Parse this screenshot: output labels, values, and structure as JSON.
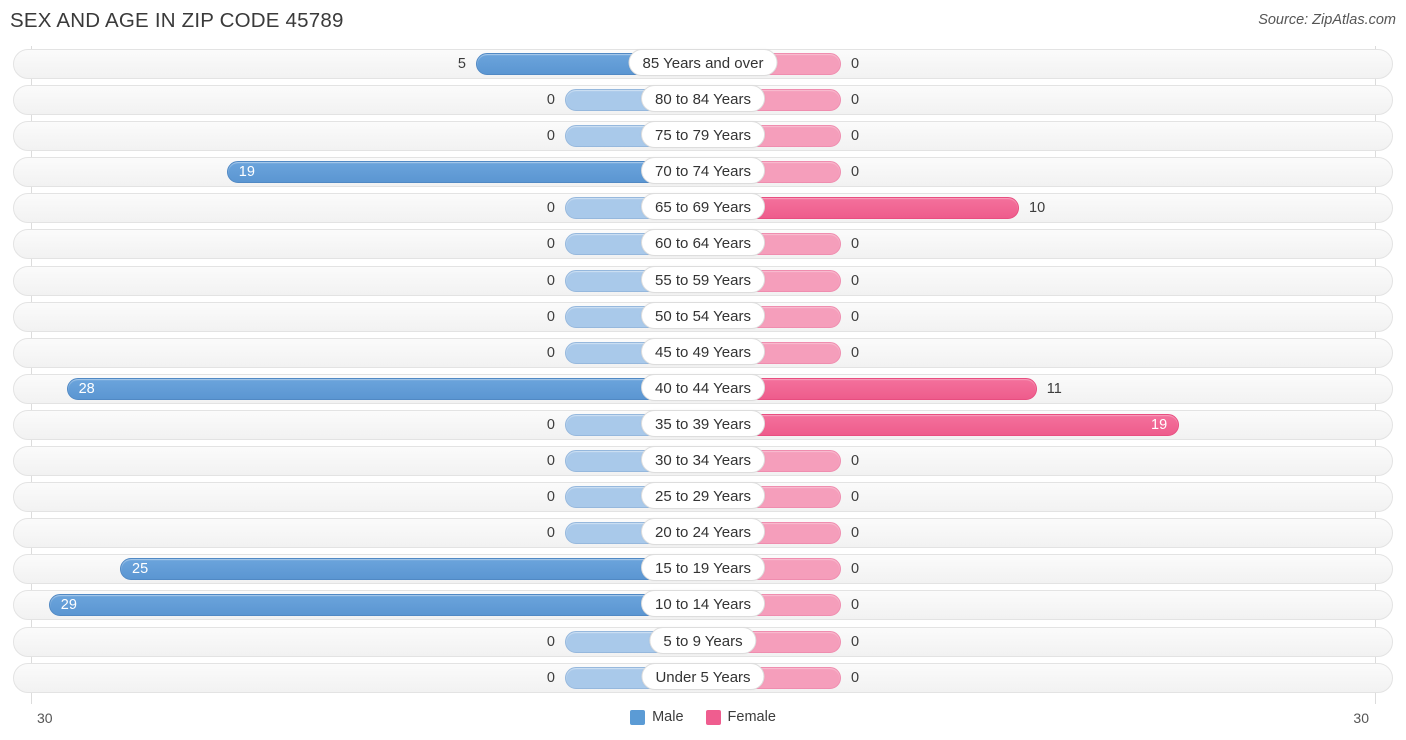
{
  "header": {
    "title": "SEX AND AGE IN ZIP CODE 45789",
    "source": "Source: ZipAtlas.com"
  },
  "legend": {
    "male_label": "Male",
    "female_label": "Female",
    "male_color": "#5b9bd5",
    "female_color": "#ef5d8f"
  },
  "axis": {
    "left_end": "30",
    "right_end": "30",
    "max": 30
  },
  "chart_data": {
    "type": "bar",
    "title": "SEX AND AGE IN ZIP CODE 45789",
    "subtitle": "Source: ZipAtlas.com",
    "orientation": "horizontal",
    "style": "population-pyramid",
    "xlabel": "",
    "ylabel": "",
    "xlim": [
      30,
      30
    ],
    "grid": true,
    "legend_position": "bottom-center",
    "categories": [
      "85 Years and over",
      "80 to 84 Years",
      "75 to 79 Years",
      "70 to 74 Years",
      "65 to 69 Years",
      "60 to 64 Years",
      "55 to 59 Years",
      "50 to 54 Years",
      "45 to 49 Years",
      "40 to 44 Years",
      "35 to 39 Years",
      "30 to 34 Years",
      "25 to 29 Years",
      "20 to 24 Years",
      "15 to 19 Years",
      "10 to 14 Years",
      "5 to 9 Years",
      "Under 5 Years"
    ],
    "series": [
      {
        "name": "Male",
        "color": "#5b9bd5",
        "values": [
          5,
          0,
          0,
          19,
          0,
          0,
          0,
          0,
          0,
          28,
          0,
          0,
          0,
          0,
          25,
          29,
          0,
          0
        ]
      },
      {
        "name": "Female",
        "color": "#ef5d8f",
        "values": [
          0,
          0,
          0,
          0,
          10,
          0,
          0,
          0,
          0,
          11,
          19,
          0,
          0,
          0,
          0,
          0,
          0,
          0
        ]
      }
    ]
  },
  "rows": [
    {
      "label": "85 Years and over",
      "male": "5",
      "female": "0"
    },
    {
      "label": "80 to 84 Years",
      "male": "0",
      "female": "0"
    },
    {
      "label": "75 to 79 Years",
      "male": "0",
      "female": "0"
    },
    {
      "label": "70 to 74 Years",
      "male": "19",
      "female": "0"
    },
    {
      "label": "65 to 69 Years",
      "male": "0",
      "female": "10"
    },
    {
      "label": "60 to 64 Years",
      "male": "0",
      "female": "0"
    },
    {
      "label": "55 to 59 Years",
      "male": "0",
      "female": "0"
    },
    {
      "label": "50 to 54 Years",
      "male": "0",
      "female": "0"
    },
    {
      "label": "45 to 49 Years",
      "male": "0",
      "female": "0"
    },
    {
      "label": "40 to 44 Years",
      "male": "28",
      "female": "11"
    },
    {
      "label": "35 to 39 Years",
      "male": "0",
      "female": "19"
    },
    {
      "label": "30 to 34 Years",
      "male": "0",
      "female": "0"
    },
    {
      "label": "25 to 29 Years",
      "male": "0",
      "female": "0"
    },
    {
      "label": "20 to 24 Years",
      "male": "0",
      "female": "0"
    },
    {
      "label": "15 to 19 Years",
      "male": "25",
      "female": "0"
    },
    {
      "label": "10 to 14 Years",
      "male": "29",
      "female": "0"
    },
    {
      "label": "5 to 9 Years",
      "male": "0",
      "female": "0"
    },
    {
      "label": "Under 5 Years",
      "male": "0",
      "female": "0"
    }
  ]
}
